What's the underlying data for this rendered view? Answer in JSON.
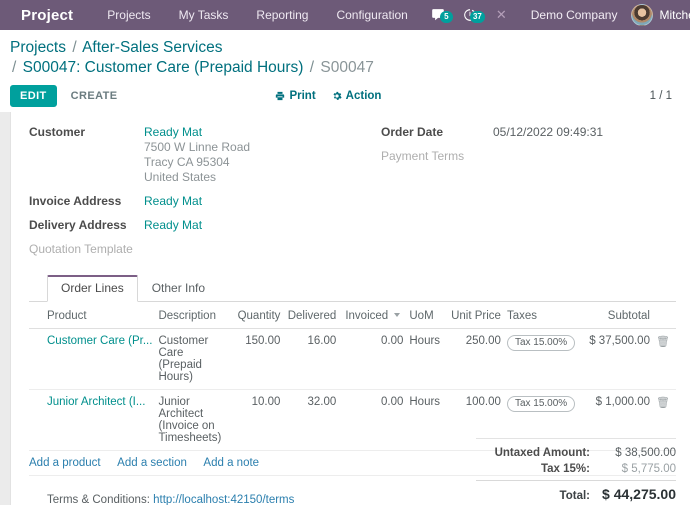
{
  "navbar": {
    "apps_icon": "apps-grid-icon",
    "brand": "Project",
    "menu": [
      {
        "label": "Projects"
      },
      {
        "label": "My Tasks"
      },
      {
        "label": "Reporting"
      },
      {
        "label": "Configuration"
      }
    ],
    "messages_icon": "chat-bubble-icon",
    "messages_count": "5",
    "activities_icon": "clock-icon",
    "activities_count": "37",
    "close_icon": "close-x-icon",
    "company": "Demo Company",
    "user_name": "Mitche",
    "avatar_icon": "user-avatar",
    "accent_color": "#00a09d",
    "navbar_color": "#6d5a78"
  },
  "control_panel": {
    "breadcrumb": {
      "root": "Projects",
      "sep": "/",
      "level2": "After-Sales Services",
      "level3": "S00047: Customer Care (Prepaid Hours)",
      "current": "S00047"
    },
    "edit_label": "EDIT",
    "create_label": "CREATE",
    "print_label": "Print",
    "print_icon": "printer-icon",
    "action_label": "Action",
    "action_icon": "gear-icon",
    "pager": "1 / 1"
  },
  "form": {
    "left": [
      {
        "label": "Customer",
        "value": "Ready Mat",
        "is_link": true,
        "address": [
          "7500 W Linne Road",
          "Tracy CA 95304",
          "United States"
        ]
      },
      {
        "label": "Invoice Address",
        "value": "Ready Mat",
        "is_link": true,
        "address": []
      },
      {
        "label": "Delivery Address",
        "value": "Ready Mat",
        "is_link": true,
        "address": []
      },
      {
        "label": "Quotation Template",
        "value": "",
        "is_link": false,
        "address": []
      }
    ],
    "right": [
      {
        "label": "Order Date",
        "value": "05/12/2022 09:49:31",
        "muted_label": false
      },
      {
        "label": "Payment Terms",
        "value": "",
        "muted_label": true
      }
    ]
  },
  "notebook": {
    "tabs": [
      {
        "label": "Order Lines",
        "active": true
      },
      {
        "label": "Other Info",
        "active": false
      }
    ]
  },
  "table": {
    "headers": {
      "product": "Product",
      "description": "Description",
      "quantity": "Quantity",
      "delivered": "Delivered",
      "invoiced": "Invoiced",
      "uom": "UoM",
      "unit_price": "Unit Price",
      "taxes": "Taxes",
      "subtotal": "Subtotal"
    },
    "optional_columns_icon": "chevron-down-icon",
    "rows": [
      {
        "product": "Customer Care (Pr...",
        "description": "Customer Care (Prepaid Hours)",
        "quantity": "150.00",
        "delivered": "16.00",
        "invoiced": "0.00",
        "uom": "Hours",
        "unit_price": "250.00",
        "taxes": "Tax 15.00%",
        "subtotal": "$ 37,500.00",
        "delete_icon": "trash-icon"
      },
      {
        "product": "Junior Architect (I...",
        "description": "Junior Architect (Invoice on Timesheets)",
        "quantity": "10.00",
        "delivered": "32.00",
        "invoiced": "0.00",
        "uom": "Hours",
        "unit_price": "100.00",
        "taxes": "Tax 15.00%",
        "subtotal": "$ 1,000.00",
        "delete_icon": "trash-icon"
      }
    ],
    "add_product": "Add a product",
    "add_section": "Add a section",
    "add_note": "Add a note"
  },
  "footer": {
    "terms_label": "Terms & Conditions:",
    "terms_url": "http://localhost:42150/terms",
    "totals": {
      "untaxed_label": "Untaxed Amount:",
      "untaxed_value": "$ 38,500.00",
      "tax_label": "Tax 15%:",
      "tax_value": "$ 5,775.00",
      "total_label": "Total:",
      "total_value": "$ 44,275.00"
    }
  }
}
